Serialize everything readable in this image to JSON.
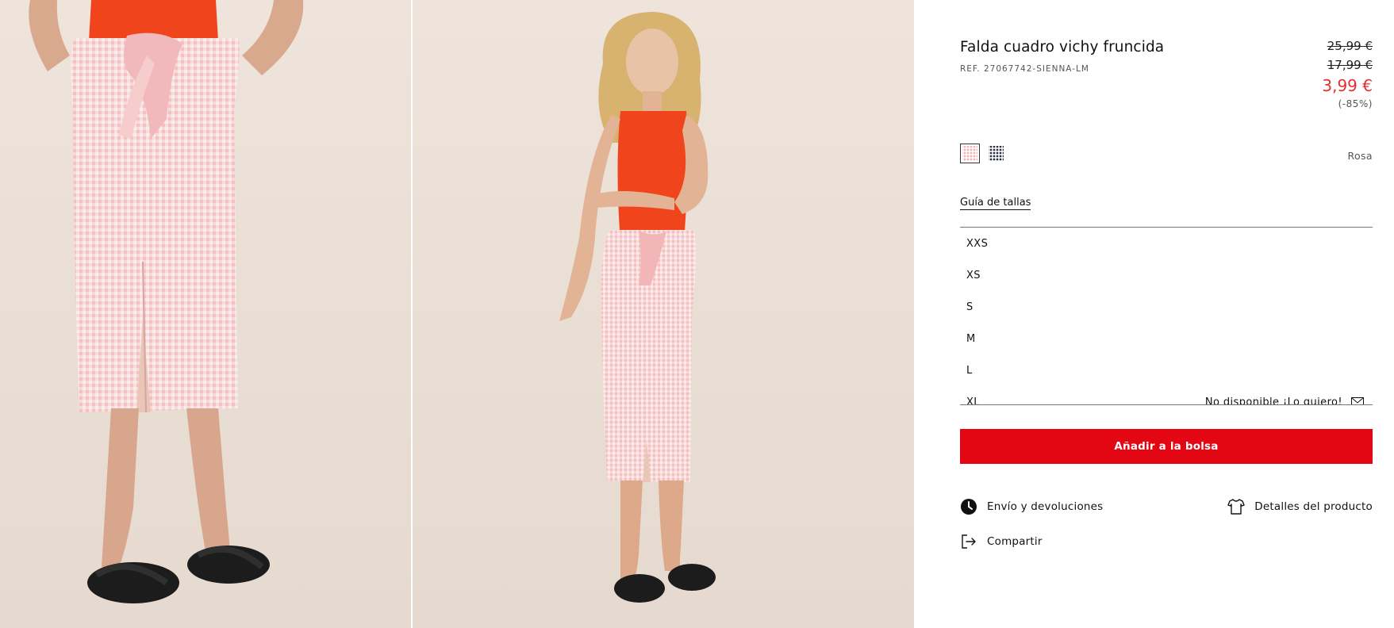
{
  "product": {
    "title": "Falda cuadro vichy fruncida",
    "ref": "REF. 27067742-SIENNA-LM",
    "prices": {
      "original": "25,99 €",
      "previous": "17,99 €",
      "current": "3,99 €",
      "discount": "(-85%)"
    },
    "colors": [
      {
        "name": "Rosa",
        "hex": "#f3b3b7",
        "selected": true
      },
      {
        "name": "navy-check",
        "hex": "#2a2f45",
        "selected": false
      }
    ],
    "selected_color_label": "Rosa"
  },
  "size_guide_label": "Guía de tallas",
  "sizes": [
    {
      "label": "XXS",
      "status": ""
    },
    {
      "label": "XS",
      "status": ""
    },
    {
      "label": "S",
      "status": ""
    },
    {
      "label": "M",
      "status": ""
    },
    {
      "label": "L",
      "status": ""
    },
    {
      "label": "XL",
      "status": "No disponible ¡Lo quiero!"
    }
  ],
  "actions": {
    "add_to_bag": "Añadir a la bolsa",
    "shipping": "Envío y devoluciones",
    "details": "Detalles del producto",
    "share": "Compartir"
  },
  "colors": {
    "accent_red": "#e30613",
    "sale_price": "#e32f2f",
    "background_photo": "#ebe1d8"
  },
  "icons": [
    "clock-icon",
    "tshirt-icon",
    "share-icon",
    "envelope-icon"
  ]
}
